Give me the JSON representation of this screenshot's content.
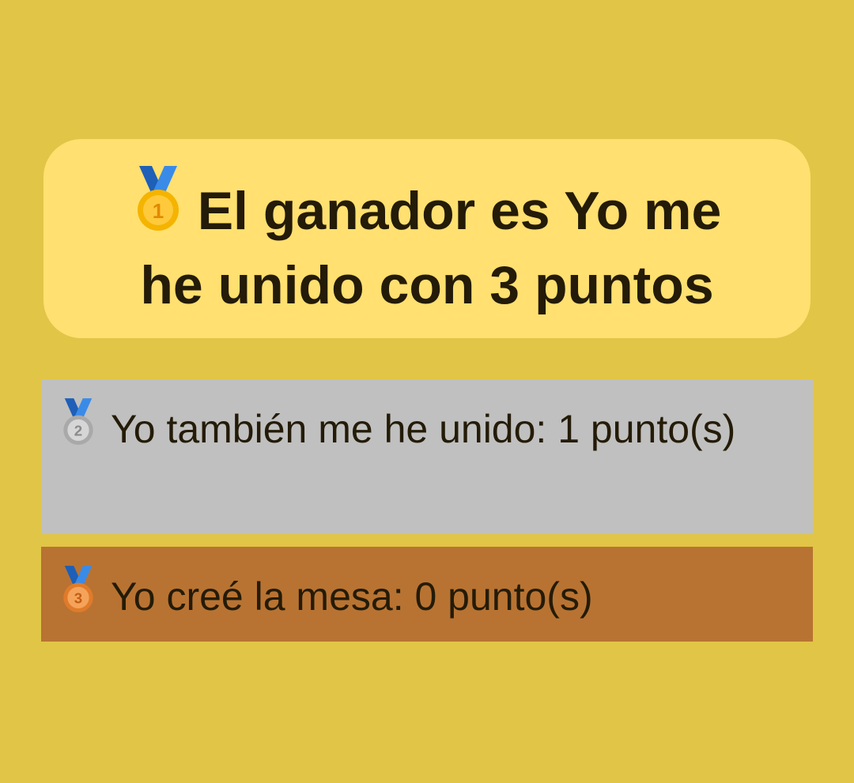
{
  "colors": {
    "background": "#E1C546",
    "winner_card": "#FFE070",
    "second_place": "#C0C0C0",
    "third_place": "#B87332",
    "text": "#241B08",
    "ribbon": "#3A7BD5",
    "gold": "#F4B400",
    "silver": "#B9B9B9",
    "bronze": "#E07B2A"
  },
  "winner": {
    "medal_icon": "first-place-medal-icon",
    "text": "El ganador es Yo me he unido con 3 puntos"
  },
  "rankings": [
    {
      "medal_icon": "second-place-medal-icon",
      "text": "Yo también me he unido: 1 punto(s)"
    },
    {
      "medal_icon": "third-place-medal-icon",
      "text": "Yo creé la mesa: 0 punto(s)"
    }
  ]
}
